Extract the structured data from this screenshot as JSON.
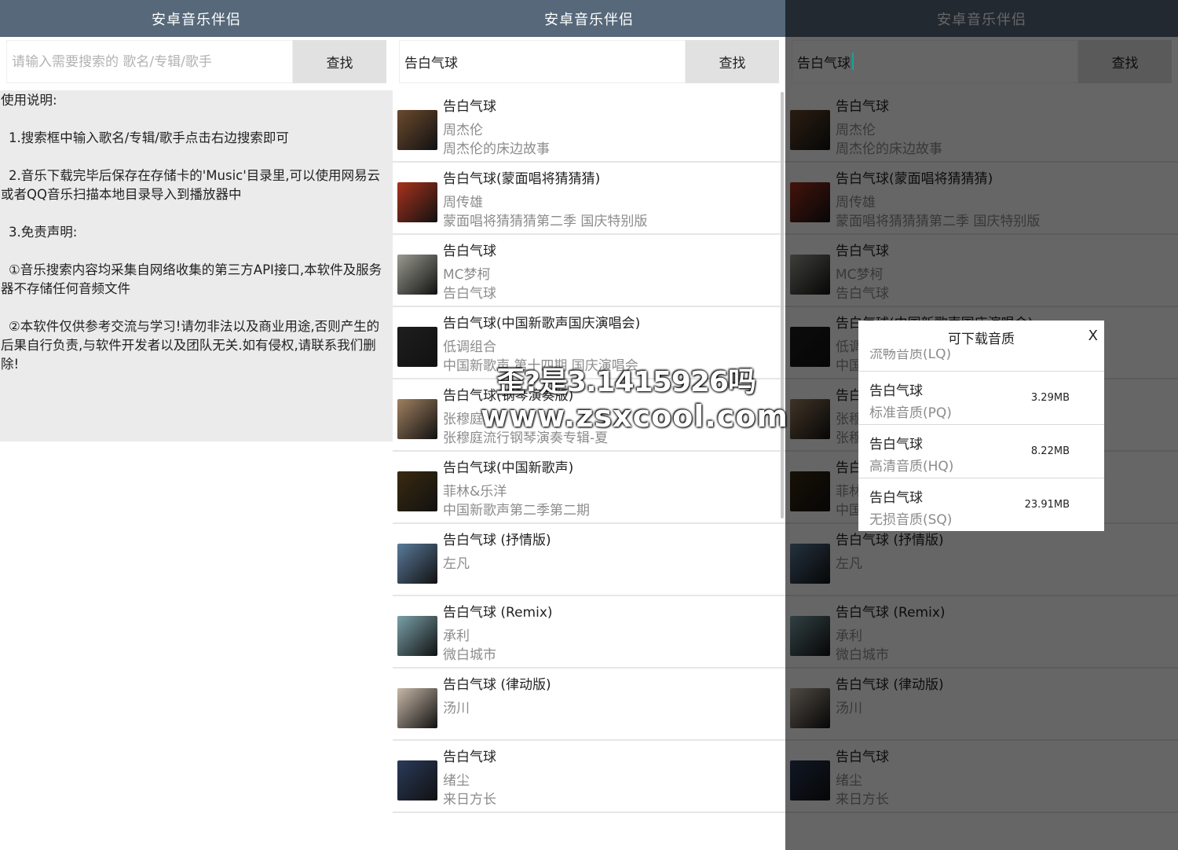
{
  "app": {
    "title": "安卓音乐伴侣"
  },
  "search": {
    "placeholder": "请输入需要搜索的 歌名/专辑/歌手",
    "query": "告白气球",
    "button_label": "查找"
  },
  "instructions": {
    "heading": "使用说明:",
    "item1": "1.搜索框中输入歌名/专辑/歌手点击右边搜索即可",
    "item2": "2.音乐下载完毕后保存在存储卡的'Music'目录里,可以使用网易云或者QQ音乐扫描本地目录导入到播放器中",
    "item3": "3.免责声明:",
    "item4": "①音乐搜索内容均采集自网络收集的第三方API接口,本软件及服务器不存储任何音频文件",
    "item5": "②本软件仅供参考交流与学习!请勿非法以及商业用途,否则产生的后果自行负责,与软件开发者以及团队无关.如有侵权,请联系我们删除!"
  },
  "results": [
    {
      "title": "告白气球",
      "artist": "周杰伦",
      "album": "周杰伦的床边故事",
      "cover_color": "#6b4a2e"
    },
    {
      "title": "告白气球(蒙面唱将猜猜猜)",
      "artist": "周传雄",
      "album": "蒙面唱将猜猜猜第二季 国庆特别版",
      "cover_color": "#a8321e"
    },
    {
      "title": "告白气球",
      "artist": "MC梦柯",
      "album": "告白气球",
      "cover_color": "#9a9a90"
    },
    {
      "title": "告白气球(中国新歌声国庆演唱会)",
      "artist": "低调组合",
      "album": "中国新歌声 第十四期 国庆演唱会",
      "cover_color": "#1e1e1e"
    },
    {
      "title": "告白气球(钢琴演奏版)",
      "artist": "张穆庭",
      "album": "张穆庭流行钢琴演奏专辑-夏",
      "cover_color": "#a08060"
    },
    {
      "title": "告白气球(中国新歌声)",
      "artist": "菲林&乐洋",
      "album": "中国新歌声第二季第二期",
      "cover_color": "#3a2a10"
    },
    {
      "title": "告白气球 (抒情版)",
      "artist": "左凡",
      "album": "",
      "cover_color": "#5a7a9a"
    },
    {
      "title": "告白气球 (Remix)",
      "artist": "承利",
      "album": "微白城市",
      "cover_color": "#7aa0a8"
    },
    {
      "title": "告白气球 (律动版)",
      "artist": "汤川",
      "album": "",
      "cover_color": "#c8b8a8"
    },
    {
      "title": "告白气球",
      "artist": "绪尘",
      "album": "来日方长",
      "cover_color": "#2a3a5a"
    }
  ],
  "watermark": {
    "line1": "歪?是3.1415926吗",
    "line2": "www.zsxcool.com"
  },
  "dialog": {
    "title": "可下载音质",
    "close_label": "X",
    "partial_label": "流畅音质(LQ)",
    "options": [
      {
        "title": "告白气球",
        "quality": "标准音质(PQ)",
        "size": "3.29MB"
      },
      {
        "title": "告白气球",
        "quality": "高清音质(HQ)",
        "size": "8.22MB"
      },
      {
        "title": "告白气球",
        "quality": "无损音质(SQ)",
        "size": "23.91MB"
      }
    ]
  },
  "colors": {
    "titlebar": "#56687a",
    "button_bg": "#e1e1e1",
    "panel_bg": "#ebebeb",
    "secondary_text": "#8c8c8c"
  }
}
